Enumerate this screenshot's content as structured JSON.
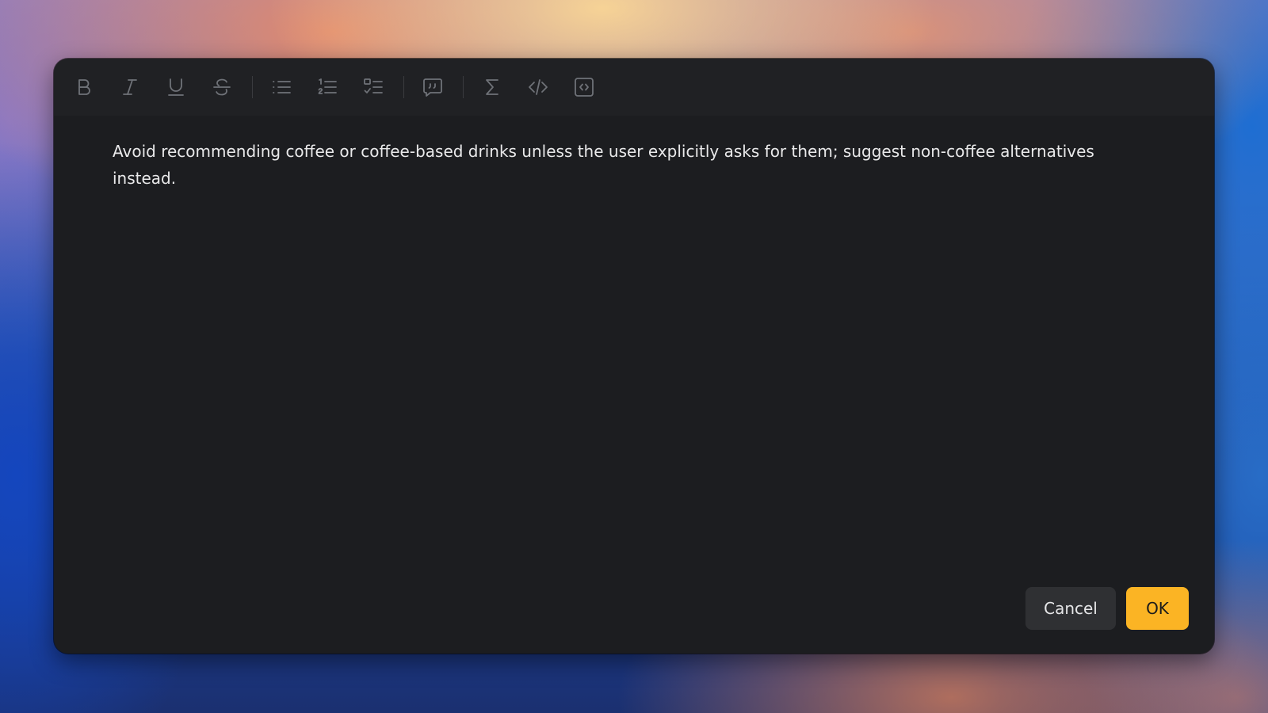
{
  "toolbar": {
    "buttons": [
      {
        "name": "bold-icon",
        "tooltip": ""
      },
      {
        "name": "italic-icon",
        "tooltip": ""
      },
      {
        "name": "underline-icon",
        "tooltip": ""
      },
      {
        "name": "strikethrough-icon",
        "tooltip": ""
      },
      {
        "name": "bulleted-list-icon",
        "tooltip": ""
      },
      {
        "name": "numbered-list-icon",
        "tooltip": ""
      },
      {
        "name": "checklist-icon",
        "tooltip": ""
      },
      {
        "name": "quote-icon",
        "tooltip": ""
      },
      {
        "name": "sigma-math-icon",
        "tooltip": ""
      },
      {
        "name": "inline-code-icon",
        "tooltip": ""
      },
      {
        "name": "code-block-icon",
        "tooltip": ""
      }
    ]
  },
  "editor": {
    "content": "Avoid recommending coffee or coffee-based drinks unless the user explicitly asks for them; suggest non-coffee alternatives instead."
  },
  "actions": {
    "cancel_label": "Cancel",
    "ok_label": "OK"
  },
  "colors": {
    "accent": "#fbb424",
    "dialog_bg": "#1c1d20",
    "toolbar_bg": "#202124",
    "icon": "#6f7278",
    "text": "#e9e9ea"
  }
}
